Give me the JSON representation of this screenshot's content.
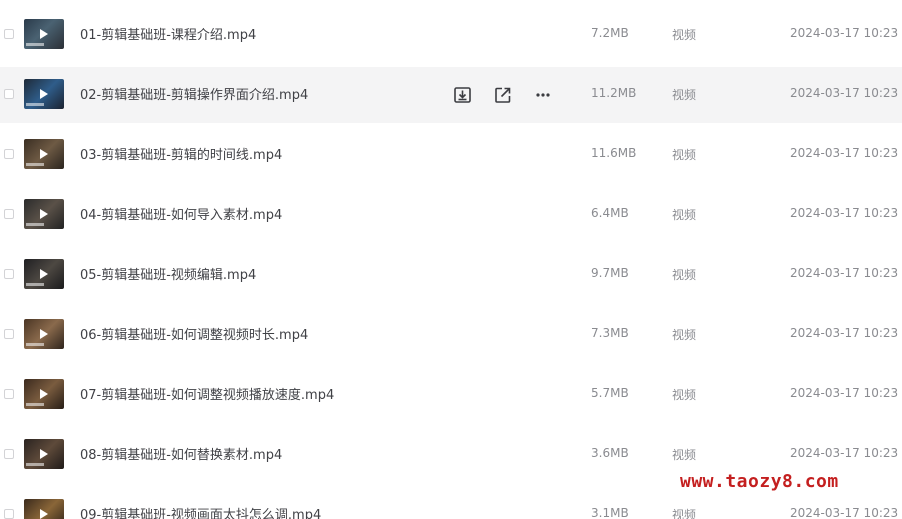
{
  "files": [
    {
      "name": "01-剪辑基础班-课程介绍.mp4",
      "size": "7.2MB",
      "type": "视频",
      "modified": "2024-03-17 10:23",
      "hovered": false
    },
    {
      "name": "02-剪辑基础班-剪辑操作界面介绍.mp4",
      "size": "11.2MB",
      "type": "视频",
      "modified": "2024-03-17 10:23",
      "hovered": true
    },
    {
      "name": "03-剪辑基础班-剪辑的时间线.mp4",
      "size": "11.6MB",
      "type": "视频",
      "modified": "2024-03-17 10:23",
      "hovered": false
    },
    {
      "name": "04-剪辑基础班-如何导入素材.mp4",
      "size": "6.4MB",
      "type": "视频",
      "modified": "2024-03-17 10:23",
      "hovered": false
    },
    {
      "name": "05-剪辑基础班-视频编辑.mp4",
      "size": "9.7MB",
      "type": "视频",
      "modified": "2024-03-17 10:23",
      "hovered": false
    },
    {
      "name": "06-剪辑基础班-如何调整视频时长.mp4",
      "size": "7.3MB",
      "type": "视频",
      "modified": "2024-03-17 10:23",
      "hovered": false
    },
    {
      "name": "07-剪辑基础班-如何调整视频播放速度.mp4",
      "size": "5.7MB",
      "type": "视频",
      "modified": "2024-03-17 10:23",
      "hovered": false
    },
    {
      "name": "08-剪辑基础班-如何替换素材.mp4",
      "size": "3.6MB",
      "type": "视频",
      "modified": "2024-03-17 10:23",
      "hovered": false
    },
    {
      "name": "09-剪辑基础班-视频画面太抖怎么调.mp4",
      "size": "3.1MB",
      "type": "视频",
      "modified": "2024-03-17 10:23",
      "hovered": false
    }
  ],
  "row_actions": {
    "download_icon": "download-icon",
    "share_icon": "share-icon",
    "more_icon": "more-icon"
  },
  "watermark": "www.taozy8.com",
  "colors": {
    "hover_row": "#f4f4f5",
    "text_primary": "#404146",
    "text_secondary": "#8a8b90",
    "watermark": "#c41f1f"
  }
}
